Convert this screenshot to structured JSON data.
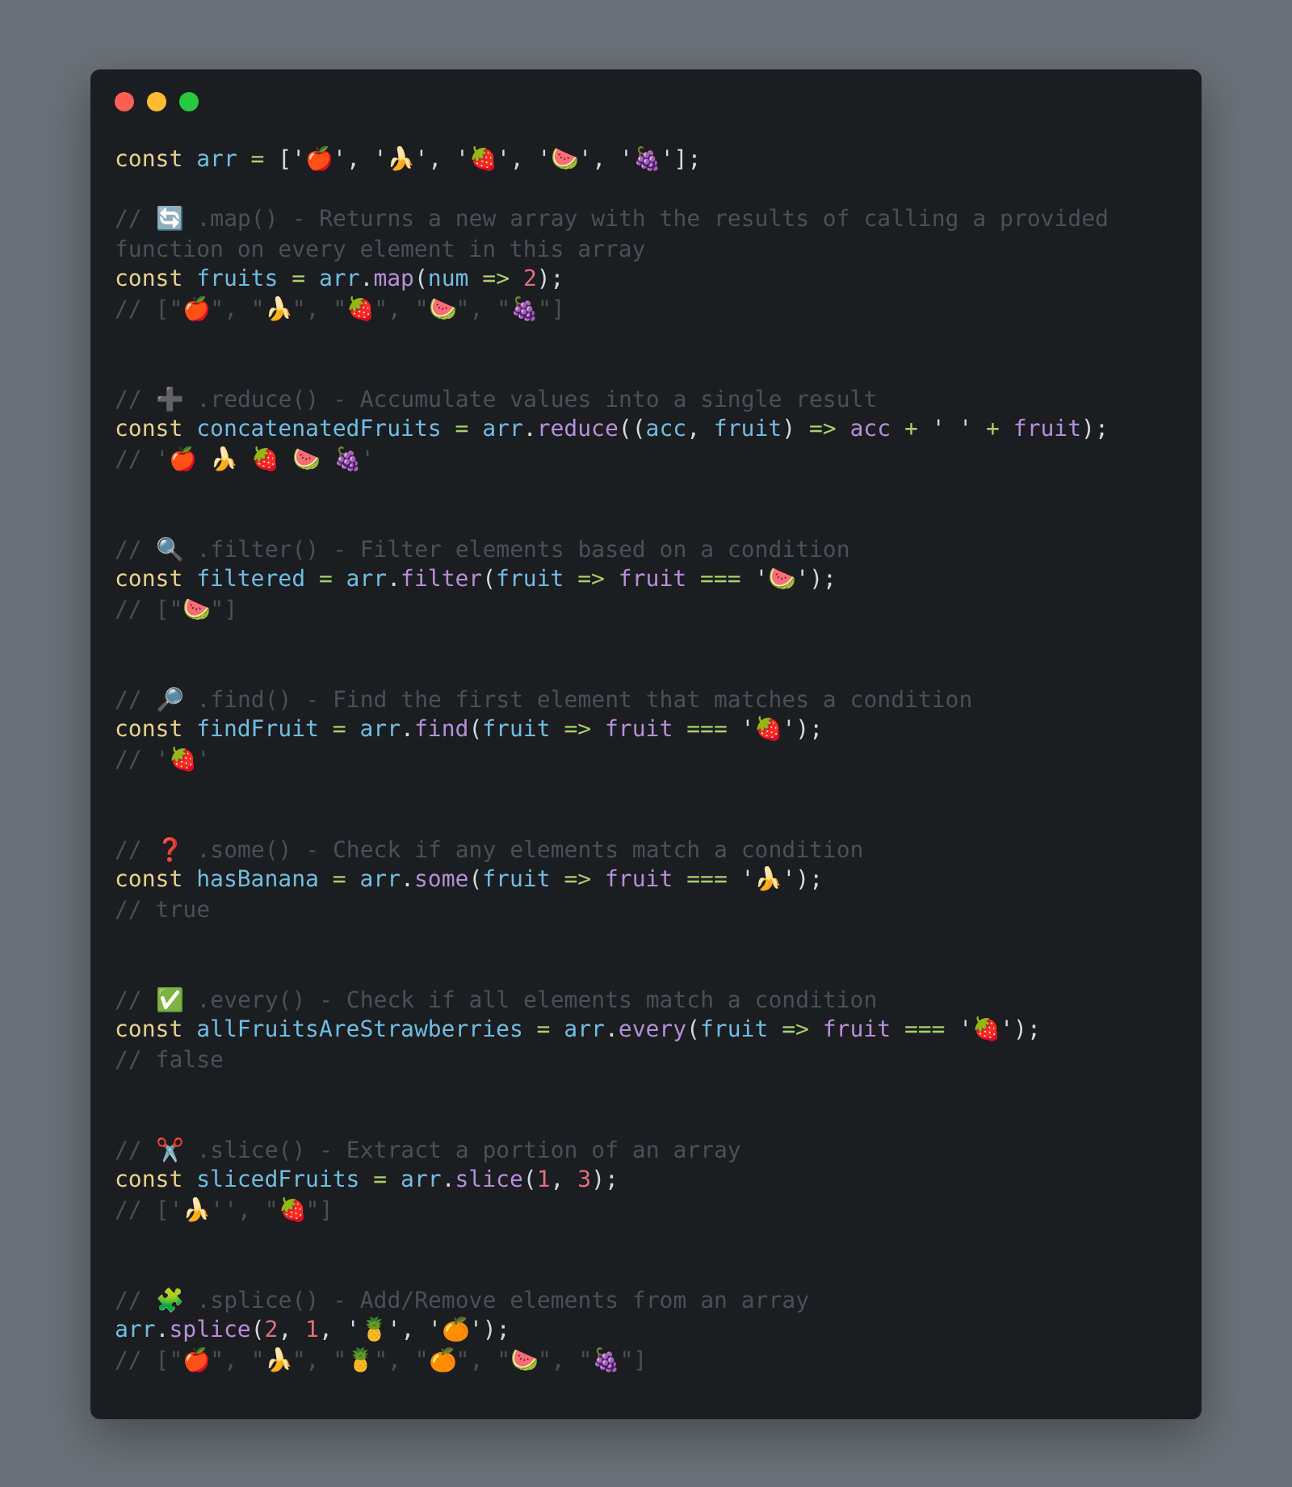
{
  "window": {
    "controls": [
      {
        "color": "#ff5f57"
      },
      {
        "color": "#febc2e"
      },
      {
        "color": "#28c840"
      }
    ]
  },
  "code_blocks": [
    [
      [
        {
          "kind": "keyword",
          "text": "const"
        },
        {
          "kind": "variable",
          "text": " arr"
        },
        {
          "kind": "operator",
          "text": " ="
        },
        {
          "kind": "plain",
          "text": " ['🍎', '🍌', '🍓', '🍉', '🍇'];"
        }
      ]
    ],
    [
      [
        {
          "kind": "comment",
          "text": "// 🔄 .map() - Returns a new array with the results of calling a provided function on every element in this array"
        }
      ],
      [
        {
          "kind": "keyword",
          "text": "const"
        },
        {
          "kind": "variable",
          "text": " fruits"
        },
        {
          "kind": "operator",
          "text": " ="
        },
        {
          "kind": "variable",
          "text": " arr"
        },
        {
          "kind": "plain",
          "text": "."
        },
        {
          "kind": "method",
          "text": "map"
        },
        {
          "kind": "plain",
          "text": "("
        },
        {
          "kind": "variable",
          "text": "num"
        },
        {
          "kind": "operator",
          "text": " =>"
        },
        {
          "kind": "number",
          "text": " 2"
        },
        {
          "kind": "plain",
          "text": ");"
        }
      ],
      [
        {
          "kind": "comment",
          "text": "// [\"🍎\", \"🍌\", \"🍓\", \"🍉\", \"🍇\"]"
        }
      ]
    ],
    [
      [
        {
          "kind": "comment",
          "text": "// ➕ .reduce() - Accumulate values into a single result"
        }
      ],
      [
        {
          "kind": "keyword",
          "text": "const"
        },
        {
          "kind": "variable",
          "text": " concatenatedFruits"
        },
        {
          "kind": "operator",
          "text": " ="
        },
        {
          "kind": "variable",
          "text": " arr"
        },
        {
          "kind": "plain",
          "text": "."
        },
        {
          "kind": "method",
          "text": "reduce"
        },
        {
          "kind": "plain",
          "text": "(("
        },
        {
          "kind": "variable",
          "text": "acc"
        },
        {
          "kind": "plain",
          "text": ","
        },
        {
          "kind": "variable",
          "text": " fruit"
        },
        {
          "kind": "plain",
          "text": ")"
        },
        {
          "kind": "operator",
          "text": " =>"
        },
        {
          "kind": "param",
          "text": " acc"
        },
        {
          "kind": "operator",
          "text": " +"
        },
        {
          "kind": "plain",
          "text": " ' '"
        },
        {
          "kind": "operator",
          "text": " +"
        },
        {
          "kind": "param",
          "text": " fruit"
        },
        {
          "kind": "plain",
          "text": ");"
        }
      ],
      [
        {
          "kind": "comment",
          "text": "// '🍎 🍌 🍓 🍉 🍇'"
        }
      ]
    ],
    [
      [
        {
          "kind": "comment",
          "text": "// 🔍 .filter() - Filter elements based on a condition"
        }
      ],
      [
        {
          "kind": "keyword",
          "text": "const"
        },
        {
          "kind": "variable",
          "text": " filtered"
        },
        {
          "kind": "operator",
          "text": " ="
        },
        {
          "kind": "variable",
          "text": " arr"
        },
        {
          "kind": "plain",
          "text": "."
        },
        {
          "kind": "method",
          "text": "filter"
        },
        {
          "kind": "plain",
          "text": "("
        },
        {
          "kind": "variable",
          "text": "fruit"
        },
        {
          "kind": "operator",
          "text": " =>"
        },
        {
          "kind": "param",
          "text": " fruit"
        },
        {
          "kind": "operator",
          "text": " ==="
        },
        {
          "kind": "plain",
          "text": " '🍉');"
        }
      ],
      [
        {
          "kind": "comment",
          "text": "// [\"🍉\"]"
        }
      ]
    ],
    [
      [
        {
          "kind": "comment",
          "text": "// 🔎 .find() - Find the first element that matches a condition"
        }
      ],
      [
        {
          "kind": "keyword",
          "text": "const"
        },
        {
          "kind": "variable",
          "text": " findFruit"
        },
        {
          "kind": "operator",
          "text": " ="
        },
        {
          "kind": "variable",
          "text": " arr"
        },
        {
          "kind": "plain",
          "text": "."
        },
        {
          "kind": "method",
          "text": "find"
        },
        {
          "kind": "plain",
          "text": "("
        },
        {
          "kind": "variable",
          "text": "fruit"
        },
        {
          "kind": "operator",
          "text": " =>"
        },
        {
          "kind": "param",
          "text": " fruit"
        },
        {
          "kind": "operator",
          "text": " ==="
        },
        {
          "kind": "plain",
          "text": " '🍓');"
        }
      ],
      [
        {
          "kind": "comment",
          "text": "// '🍓'"
        }
      ]
    ],
    [
      [
        {
          "kind": "comment",
          "text": "// ❓ .some() - Check if any elements match a condition"
        }
      ],
      [
        {
          "kind": "keyword",
          "text": "const"
        },
        {
          "kind": "variable",
          "text": " hasBanana"
        },
        {
          "kind": "operator",
          "text": " ="
        },
        {
          "kind": "variable",
          "text": " arr"
        },
        {
          "kind": "plain",
          "text": "."
        },
        {
          "kind": "method",
          "text": "some"
        },
        {
          "kind": "plain",
          "text": "("
        },
        {
          "kind": "variable",
          "text": "fruit"
        },
        {
          "kind": "operator",
          "text": " =>"
        },
        {
          "kind": "param",
          "text": " fruit"
        },
        {
          "kind": "operator",
          "text": " ==="
        },
        {
          "kind": "plain",
          "text": " '🍌');"
        }
      ],
      [
        {
          "kind": "comment",
          "text": "// true"
        }
      ]
    ],
    [
      [
        {
          "kind": "comment",
          "text": "// ✅ .every() - Check if all elements match a condition"
        }
      ],
      [
        {
          "kind": "keyword",
          "text": "const"
        },
        {
          "kind": "variable",
          "text": " allFruitsAreStrawberries"
        },
        {
          "kind": "operator",
          "text": " ="
        },
        {
          "kind": "variable",
          "text": " arr"
        },
        {
          "kind": "plain",
          "text": "."
        },
        {
          "kind": "method",
          "text": "every"
        },
        {
          "kind": "plain",
          "text": "("
        },
        {
          "kind": "variable",
          "text": "fruit"
        },
        {
          "kind": "operator",
          "text": " =>"
        },
        {
          "kind": "param",
          "text": " fruit"
        },
        {
          "kind": "operator",
          "text": " ==="
        },
        {
          "kind": "plain",
          "text": " '🍓');"
        }
      ],
      [
        {
          "kind": "comment",
          "text": "// false"
        }
      ]
    ],
    [
      [
        {
          "kind": "comment",
          "text": "// ✂️ .slice() - Extract a portion of an array"
        }
      ],
      [
        {
          "kind": "keyword",
          "text": "const"
        },
        {
          "kind": "variable",
          "text": " slicedFruits"
        },
        {
          "kind": "operator",
          "text": " ="
        },
        {
          "kind": "variable",
          "text": " arr"
        },
        {
          "kind": "plain",
          "text": "."
        },
        {
          "kind": "method",
          "text": "slice"
        },
        {
          "kind": "plain",
          "text": "("
        },
        {
          "kind": "number",
          "text": "1"
        },
        {
          "kind": "plain",
          "text": ","
        },
        {
          "kind": "number",
          "text": " 3"
        },
        {
          "kind": "plain",
          "text": ");"
        }
      ],
      [
        {
          "kind": "comment",
          "text": "// ['🍌'', \"🍓\"]"
        }
      ]
    ],
    [
      [
        {
          "kind": "comment",
          "text": "// 🧩 .splice() - Add/Remove elements from an array"
        }
      ],
      [
        {
          "kind": "variable",
          "text": "arr"
        },
        {
          "kind": "plain",
          "text": "."
        },
        {
          "kind": "method",
          "text": "splice"
        },
        {
          "kind": "plain",
          "text": "("
        },
        {
          "kind": "number",
          "text": "2"
        },
        {
          "kind": "plain",
          "text": ","
        },
        {
          "kind": "number",
          "text": " 1"
        },
        {
          "kind": "plain",
          "text": ", '🍍', '🍊');"
        }
      ],
      [
        {
          "kind": "comment",
          "text": "// [\"🍎\", \"🍌\", \"🍍\", \"🍊\", \"🍉\", \"🍇\"]"
        }
      ]
    ]
  ]
}
